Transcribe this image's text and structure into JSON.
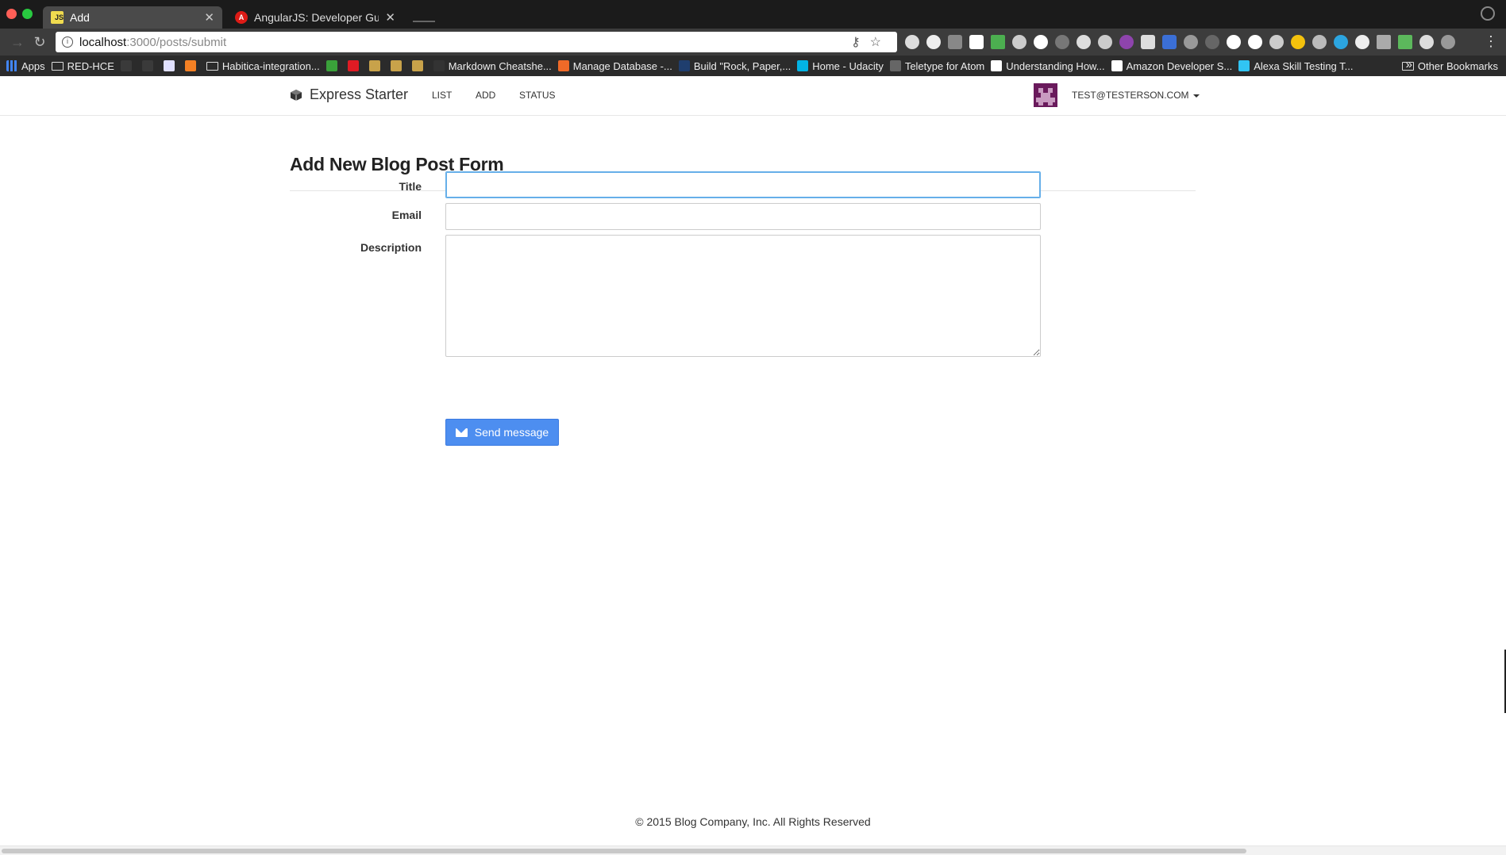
{
  "browser": {
    "tabs": [
      {
        "title": "Add",
        "favicon": "js-icon",
        "active": true
      },
      {
        "title": "AngularJS: Developer Guide: F",
        "favicon": "angular-icon",
        "active": false
      }
    ],
    "url_host": "localhost",
    "url_path": ":3000/posts/submit",
    "bookmarks": [
      {
        "label": "Apps",
        "type": "apps"
      },
      {
        "label": "RED-HCE",
        "type": "folder"
      },
      {
        "label": "",
        "type": "site",
        "color": "#3a3a3a"
      },
      {
        "label": "",
        "type": "site",
        "color": "#3a3a3a"
      },
      {
        "label": "",
        "type": "site",
        "color": "#e0e0ff"
      },
      {
        "label": "",
        "type": "site",
        "color": "#f48024"
      },
      {
        "label": "Habitica-integration...",
        "type": "folder"
      },
      {
        "label": "",
        "type": "site",
        "color": "#3aa13a"
      },
      {
        "label": "",
        "type": "site",
        "color": "#e01b24"
      },
      {
        "label": "",
        "type": "site",
        "color": "#c8a24a"
      },
      {
        "label": "",
        "type": "site",
        "color": "#c8a24a"
      },
      {
        "label": "",
        "type": "site",
        "color": "#c8a24a"
      },
      {
        "label": "Markdown Cheatshe...",
        "type": "site",
        "color": "#333333"
      },
      {
        "label": "Manage Database -...",
        "type": "site",
        "color": "#f06a28"
      },
      {
        "label": "Build \"Rock, Paper,...",
        "type": "site",
        "color": "#1f3e6e"
      },
      {
        "label": "Home - Udacity",
        "type": "site",
        "color": "#02b3e4"
      },
      {
        "label": "Teletype for Atom",
        "type": "site",
        "color": "#666666"
      },
      {
        "label": "Understanding How...",
        "type": "site",
        "color": "#ffffff"
      },
      {
        "label": "Amazon Developer S...",
        "type": "site",
        "color": "#ffffff"
      },
      {
        "label": "Alexa Skill Testing T...",
        "type": "site",
        "color": "#31c4f3"
      }
    ],
    "bookmarks_more": "»",
    "other_bookmarks": "Other Bookmarks"
  },
  "navbar": {
    "brand": "Express Starter",
    "links": [
      "LIST",
      "ADD",
      "STATUS"
    ],
    "user": "TEST@TESTERSON.COM"
  },
  "form": {
    "heading": "Add New Blog Post Form",
    "title_label": "Title",
    "email_label": "Email",
    "description_label": "Description",
    "title_value": "",
    "email_value": "",
    "description_value": "",
    "submit_label": "Send message"
  },
  "footer": {
    "text": "© 2015 Blog Company, Inc. All Rights Reserved"
  },
  "colors": {
    "primary_button": "#4d8ef0",
    "focus_border": "#66afe9",
    "avatar": "#6a1a5c"
  }
}
